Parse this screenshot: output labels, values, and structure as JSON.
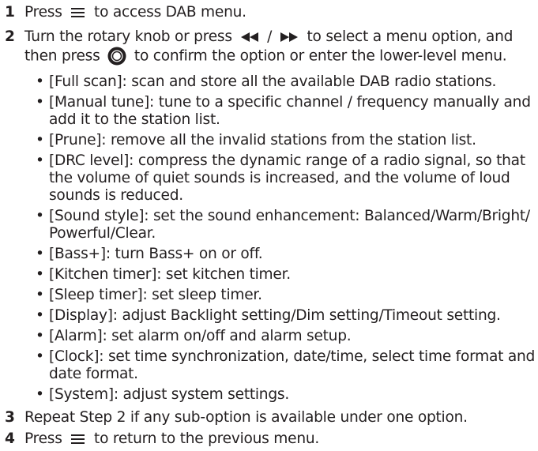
{
  "steps": [
    {
      "num": "1",
      "pre": "Press",
      "post": "to access DAB menu."
    },
    {
      "num": "2",
      "line1": "Turn the rotary knob or press",
      "line1_sep": "/",
      "line1_post": "to select a menu option, and",
      "line2_pre": "then press",
      "line2_post": "to confirm the option or enter the lower-level menu."
    },
    {
      "num": "3",
      "text": "Repeat Step 2 if any sub-option is available  under one option."
    },
    {
      "num": "4",
      "pre": "Press",
      "post": "to return to the previous menu."
    }
  ],
  "options": [
    {
      "lines": [
        "[Full scan]: scan and store all the available DAB radio stations."
      ]
    },
    {
      "lines": [
        "[Manual tune]: tune to a specific channel / frequency manually and",
        "add it to the station list."
      ]
    },
    {
      "lines": [
        "[Prune]: remove all the invalid stations  from the station list."
      ]
    },
    {
      "lines": [
        "[DRC level]: compress the dynamic range  of a radio signal, so that",
        "the volume of quiet sounds is increased, and the volume  of loud",
        "sounds is reduced."
      ]
    },
    {
      "lines": [
        "[Sound style]: set the sound enhancement: Balanced/Warm/Bright/",
        "Powerful/Clear."
      ]
    },
    {
      "lines": [
        "[Bass+]: turn Bass+ on or off."
      ]
    },
    {
      "lines": [
        "[Kitchen timer]: set kitchen timer."
      ]
    },
    {
      "lines": [
        "[Sleep timer]: set sleep timer."
      ]
    },
    {
      "lines": [
        "[Display]: adjust Backlight setting/Dim setting/Timeout setting."
      ]
    },
    {
      "lines": [
        "[Alarm]: set alarm on/off and alarm setup."
      ]
    },
    {
      "lines": [
        "[Clock]: set time synchronization, date/time, select time format and",
        "date format."
      ]
    },
    {
      "lines": [
        "[System]: adjust system settings."
      ]
    }
  ],
  "bullet_char": "•",
  "icons": [
    "menu-icon",
    "previous-icon",
    "next-icon",
    "select-knob-icon"
  ]
}
